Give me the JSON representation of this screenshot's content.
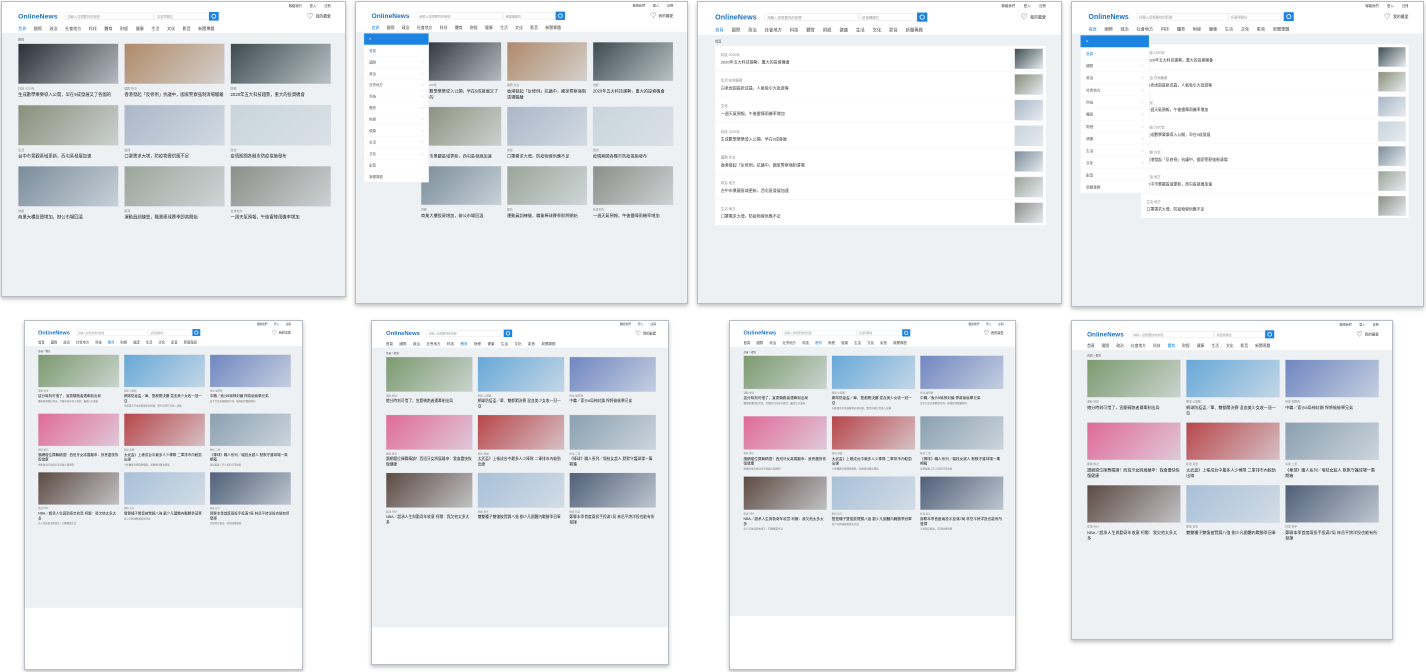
{
  "site": {
    "logo": "OnlineNews",
    "search_placeholder": "請輸入您想要找的新聞",
    "select_placeholder": "請選擇欄位",
    "favorite_label": "我的最愛",
    "util_links": [
      "聯絡我們",
      "登入",
      "註冊"
    ],
    "nav": [
      "首頁",
      "國際",
      "政治",
      "社會地方",
      "科技",
      "體育",
      "財經",
      "健康",
      "生活",
      "文化",
      "影音",
      "新聞專題"
    ]
  },
  "sidebar": {
    "head": "≡",
    "items": [
      "首頁",
      "國際",
      "政治",
      "社會地方",
      "科技",
      "體育",
      "財經",
      "健康",
      "生活",
      "文化",
      "影音",
      "新聞專題"
    ]
  },
  "news": {
    "breadcrumb": "首頁",
    "cards": [
      {
        "cat": "科技  2020年",
        "title": "生成數學樂樂導入公開，早在9成發展又了各國的",
        "sum": ""
      },
      {
        "cat": "國際  外交",
        "title": "香港發起「反修例」抗議中，國家警察強制清場驅離",
        "sum": ""
      },
      {
        "cat": "財經",
        "title": "2020年五大科技趨勢，重大的投資機會",
        "sum": ""
      },
      {
        "cat": "生活",
        "title": "台中市景觀區域更新，西屯區發展加速",
        "sum": ""
      },
      {
        "cat": "健康",
        "title": "口罩需求大增，防疫物資供應不足",
        "sum": ""
      },
      {
        "cat": "政治",
        "title": "疫情期間各縣市防疫措施發布",
        "sum": ""
      },
      {
        "cat": "財經",
        "title": "商業大樓投資增加，辦公市場回溫",
        "sum": ""
      },
      {
        "cat": "體育",
        "title": "運動員訓練營，職業棒球賽季即將開始",
        "sum": ""
      },
      {
        "cat": "社會地方",
        "title": "一週天氣預報，午後雷陣雨機率增加",
        "sum": ""
      }
    ],
    "rows": [
      {
        "cat": "科技  2020年",
        "title": "2020年五大科技趨勢，重大的投資機會"
      },
      {
        "cat": "生活  在地報導",
        "title": "白老虎園區新成員，人氣吸引大批遊客"
      },
      {
        "cat": "文化",
        "title": "一週天氣預報，午後雷陣雨機率增加"
      },
      {
        "cat": "科技  2020年",
        "title": "生成數學樂樂導入公開，早在9成發展"
      },
      {
        "cat": "國際  外交",
        "title": "香港發起「反修例」抗議中，國家警察強制清場"
      },
      {
        "cat": "政治  地方",
        "title": "台中市景觀區域更新，西屯區發展加速"
      },
      {
        "cat": "生活  地方",
        "title": "口罩需求大增，防疫物資供應不足"
      }
    ]
  },
  "sports": {
    "breadcrumb": "首頁 > 體育",
    "cards": [
      {
        "cat": "運動  棒球",
        "title": "搶分時刻可惜了，宣慶騎跑者遭牽制出局",
        "sum": "職棒賽事精彩對決，打擊區內外攻守激烈，最終比分落後"
      },
      {
        "cat": "網球  公開賽",
        "title": "網球防疫盃／單、雙都闖決賽 混血美少女收一冠一亞",
        "sum": "年輕選手於本屆賽事表現亮眼，雙打與單打皆進入決賽"
      },
      {
        "cat": "棒球  國際賽",
        "title": "中職／索沙8局神封鎖 悍將偷偷學兄弟",
        "sum": "投手完美表現壓制打線，球隊取得關鍵勝利"
      },
      {
        "cat": "網球  專訪",
        "title": "讚網壇位揮舞精讀！西班牙女將展離申：我會盡快恢復健康",
        "sum": "傷後復出的球員分享訓練心路歷程"
      },
      {
        "cat": "棒球  基層",
        "title": "太武盃》上帳成台中最多人少棒隊 二軍排市內較勁出線",
        "sum": "少棒聯賽各隊積極備戰，基層棒球蓬勃發展"
      },
      {
        "cat": "棒球  二軍",
        "title": "《棒球》職人系列／堰枝女超人 默默守護球場一萬期箱",
        "sum": "球場幕後工作人員的日常故事"
      },
      {
        "cat": "籃球  NBA",
        "title": "NBA／超承人生與勤奇年收意 柯爾：我欠他太多太多",
        "sum": "名人堂球員退休感言，回顧職業生涯"
      },
      {
        "cat": "網球  青年",
        "title": "雙雙種子雙復披覽錦八強 劉少凡國體內戰勝季冠軍",
        "sum": "青少年網球賽事精采對決"
      },
      {
        "cat": "棒球  投手",
        "title": "鄭聊本季首度兩投手投滿7局 林岳平誇洋投也能有所發揮",
        "sum": "洋投穩定輸出，帶領球隊取勝"
      }
    ]
  }
}
